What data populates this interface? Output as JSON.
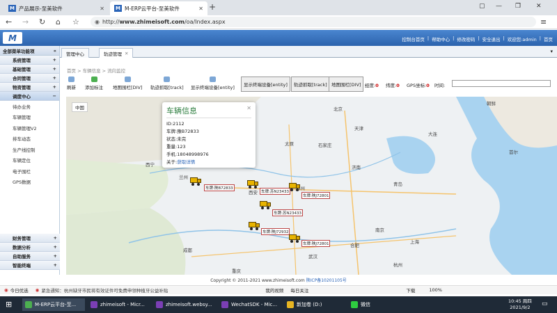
{
  "browser": {
    "tab_inactive": "产品展示-至美软件",
    "tab_active": "M-ERP云平台-至美软件",
    "url_prefix": "http://",
    "url_host": "www.zhimeisoft.com",
    "url_path": "/oa/Index.aspx"
  },
  "app": {
    "logo": "M",
    "top_links": [
      "控制台首页",
      "帮助中心",
      "修改密码",
      "安全退出",
      "欢迎您:admin",
      "首页"
    ]
  },
  "sidebar": {
    "header": "全部菜单功能项",
    "groups": [
      "系统管理",
      "基础管理",
      "合同管理",
      "物资管理"
    ],
    "open_group": "调度中心",
    "items": [
      "待办业务",
      "车辆管理",
      "车辆管理V2",
      "排车动态",
      "生产线控制",
      "车辆定位",
      "电子围栏",
      "GPS数据"
    ],
    "bottom_groups": [
      "财务管理",
      "数据分析",
      "自助服务",
      "智能终端"
    ]
  },
  "content": {
    "tabs": [
      "管理中心",
      "轨迹管理"
    ],
    "breadcrumb": "首页 > 车辆信息 > 流向监控",
    "tools": [
      "刷新",
      "添加标注",
      "地图围栏[DIV]",
      "轨迹抓取[track]",
      "显示终端设备[entity]"
    ],
    "buttons": [
      "显示终端设备[entity]",
      "轨迹抓取[track]",
      "地图围栏[DIV]"
    ],
    "gps_labels": {
      "lng": "经度:",
      "lng_val": "0",
      "lat": "纬度:",
      "lat_val": "0",
      "coord": "GPS坐标:",
      "coord_val": "0",
      "time": "时间:"
    }
  },
  "map": {
    "region_button": "中国",
    "cities": [
      "北京",
      "天津",
      "石家庄",
      "太原",
      "济南",
      "郑州",
      "西安",
      "西宁",
      "兰州",
      "成都",
      "重庆",
      "武汉",
      "南京",
      "上海",
      "杭州",
      "合肥",
      "朝鲜",
      "大连",
      "青岛",
      "首尔"
    ],
    "popup": {
      "title": "车辆信息",
      "id": "ID:2112",
      "plate": "车牌:豫B72833",
      "status": "状态:未完",
      "weight": "重量:123",
      "phone": "手机:18048998976",
      "about_label": "关于:",
      "about_link": "获取详情"
    },
    "vehicles": [
      "车牌:陕B72833",
      "车牌:苏N23433",
      "车牌:陕J72801",
      "车牌:苏N23433",
      "车牌:陕J72932",
      "车牌:陕J72801"
    ]
  },
  "footer": {
    "copyright": "Copyright © 2011-2021 www.zhimeisoft.com",
    "icp": "陕ICP备10201105号"
  },
  "statusbar": {
    "left": "今日优选",
    "notice": "紧急通知：杭州缺牙市民将有效证件可免费申领种植牙公益补贴",
    "video": "我的视频",
    "follow": "每日关注",
    "download": "下载",
    "zoom": "100%"
  },
  "taskbar": {
    "tasks": [
      "M-ERP云平台-至...",
      "zhimeisoft - Micr...",
      "zhimeisoft.websy...",
      "WechatSDK - Mic...",
      "新加卷 (D:)",
      "微信"
    ],
    "time": "10:45 周四",
    "date": "2021/9/2"
  }
}
